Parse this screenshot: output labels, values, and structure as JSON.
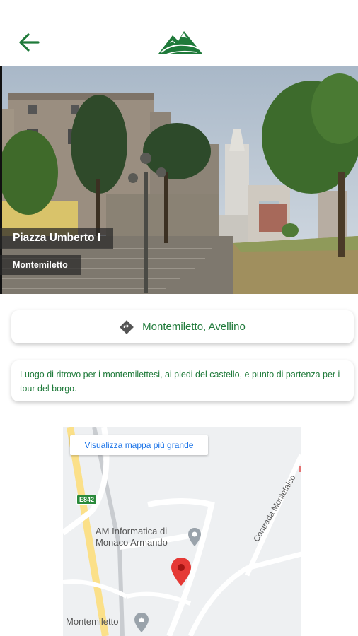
{
  "header": {
    "back_icon": "arrow-left-icon",
    "logo_icon": "mountain-logo-icon"
  },
  "hero": {
    "title": "Piazza Umberto I",
    "subtitle": "Montemiletto"
  },
  "location": {
    "icon": "directions-diamond-icon",
    "text": "Montemiletto, Avellino"
  },
  "description": {
    "text": "Luogo di ritrovo per i montemilettesi, ai piedi del castello, e punto di partenza per i tour del borgo."
  },
  "map": {
    "view_larger_label": "Visualizza mappa più grande",
    "road_code": "E842",
    "poi_name_line1": "AM Informatica di",
    "poi_name_line2": "Monaco Armando",
    "street_name": "Contrada Montefalco",
    "town_label": "Montemiletto"
  },
  "colors": {
    "brand_green": "#1f7a3a",
    "map_link_blue": "#1a73e8",
    "marker_red": "#e53935"
  }
}
